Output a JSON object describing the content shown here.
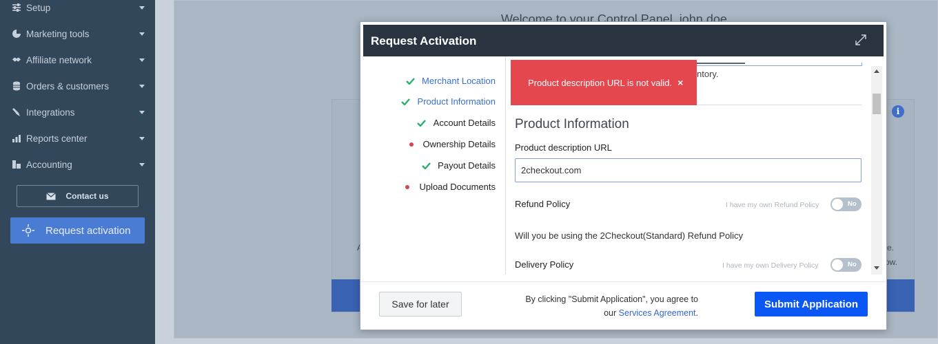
{
  "sidebar": {
    "items": [
      {
        "label": "Setup",
        "icon": "sliders-icon"
      },
      {
        "label": "Marketing tools",
        "icon": "pie-chart-icon"
      },
      {
        "label": "Affiliate network",
        "icon": "handshake-icon"
      },
      {
        "label": "Orders & customers",
        "icon": "database-icon"
      },
      {
        "label": "Integrations",
        "icon": "plug-icon"
      },
      {
        "label": "Reports center",
        "icon": "bar-chart-icon"
      },
      {
        "label": "Accounting",
        "icon": "calculator-icon"
      }
    ],
    "contact_label": "Contact us",
    "request_label": "Request activation"
  },
  "background": {
    "welcome": "Welcome to your Control Panel, john doe",
    "info_glyph": "i",
    "text_a": "A",
    "text_e": "e.",
    "text_ow": "ow."
  },
  "modal": {
    "title": "Request Activation",
    "steps": [
      {
        "label": "Merchant Location",
        "status": "complete",
        "active": true
      },
      {
        "label": "Product Information",
        "status": "complete",
        "active": true
      },
      {
        "label": "Account Details",
        "status": "complete",
        "active": false
      },
      {
        "label": "Ownership Details",
        "status": "incomplete",
        "active": false
      },
      {
        "label": "Payout Details",
        "status": "complete",
        "active": false
      },
      {
        "label": "Upload Documents",
        "status": "incomplete",
        "active": false
      }
    ],
    "toast": {
      "message": "Product description URL is not valid.",
      "close": "×"
    },
    "partial_text": "ntory.",
    "section_title": "Product Information",
    "url_label": "Product description URL",
    "url_value": "2checkout.com",
    "refund": {
      "label": "Refund Policy",
      "hint": "I have my own Refund Policy",
      "toggle": "No"
    },
    "refund_question": "Will you be using the 2Checkout(Standard) Refund Policy",
    "delivery": {
      "label": "Delivery Policy",
      "hint": "I have my own Delivery Policy",
      "toggle": "No"
    },
    "footer": {
      "save_label": "Save for later",
      "agree_text": "By clicking \"Submit Application\", you agree to",
      "agree_prefix": "our",
      "agree_link": "Services Agreement",
      "agree_suffix": ".",
      "submit_label": "Submit Application"
    }
  },
  "colors": {
    "sidebar_bg": "#33475b",
    "accent": "#0b57f5",
    "error": "#e5474f",
    "success": "#27b06e"
  }
}
